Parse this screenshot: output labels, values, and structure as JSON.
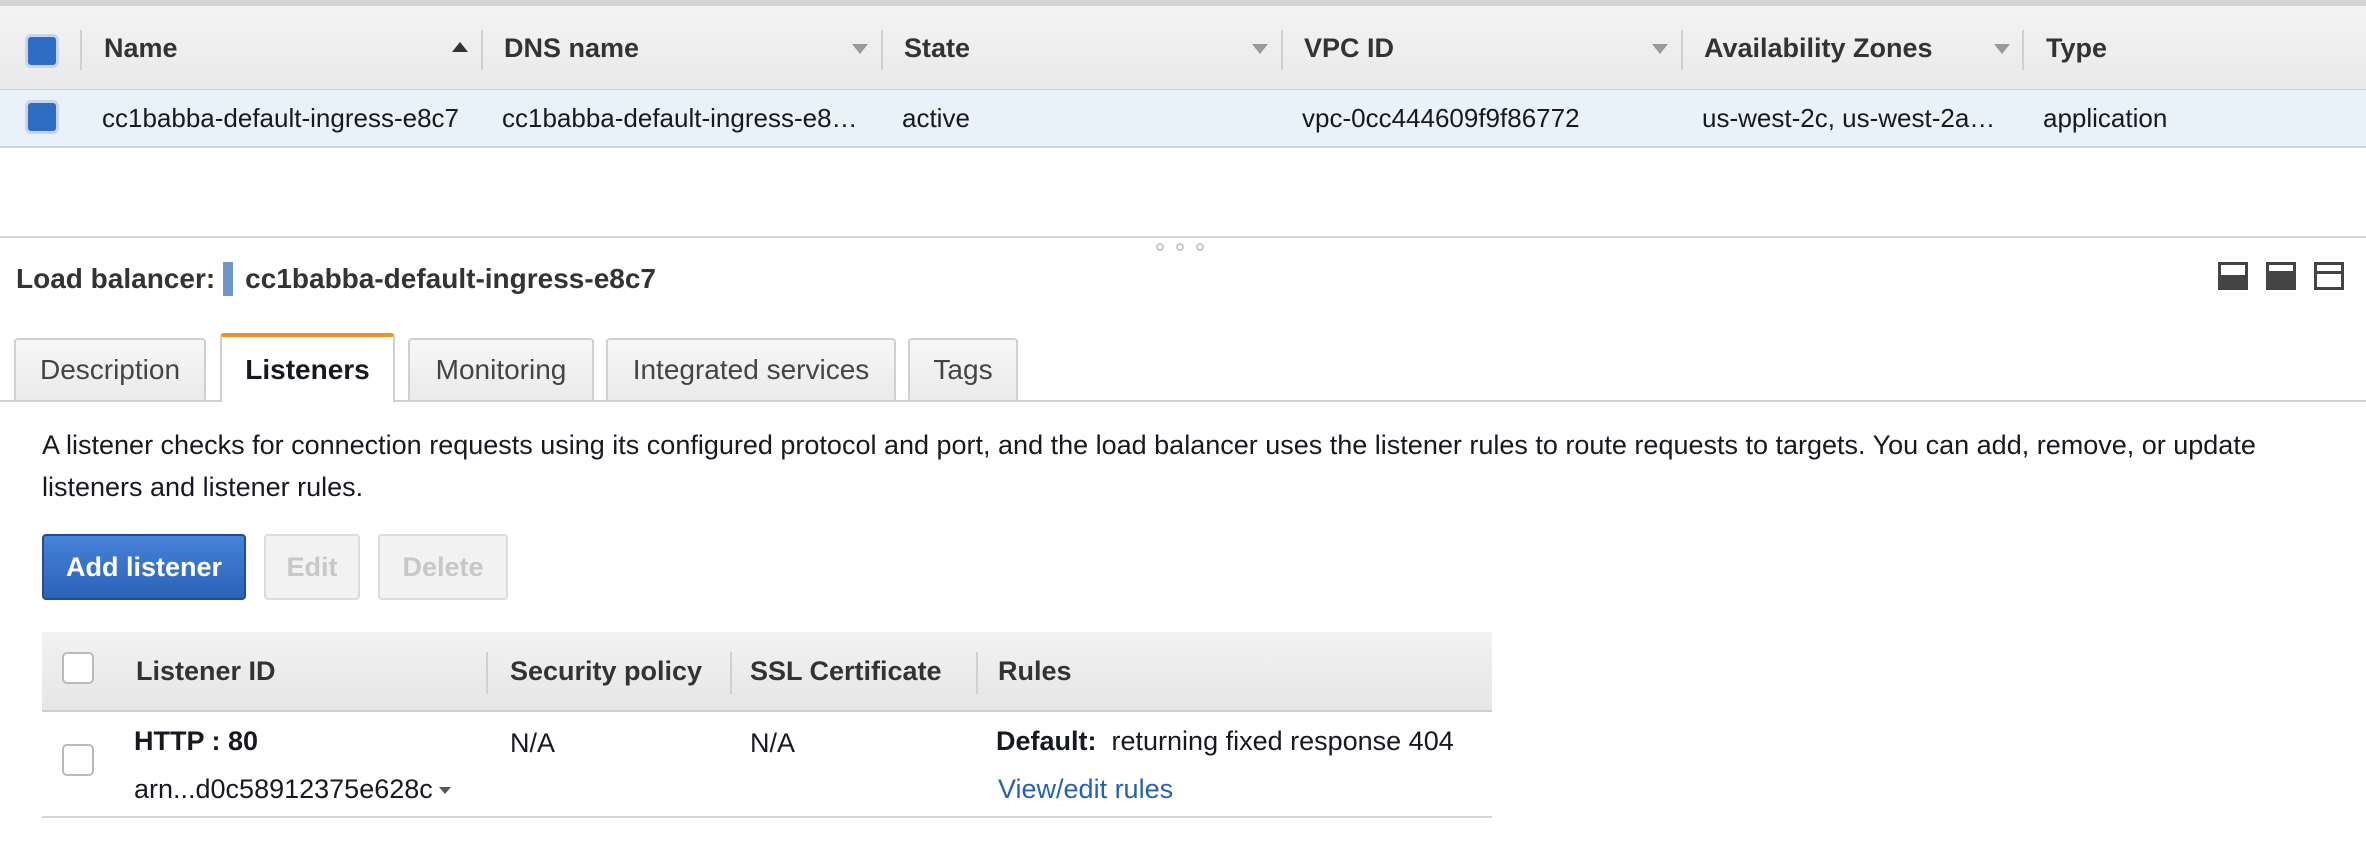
{
  "lb_table": {
    "columns": [
      {
        "label": "Name"
      },
      {
        "label": "DNS name"
      },
      {
        "label": "State"
      },
      {
        "label": "VPC ID"
      },
      {
        "label": "Availability Zones"
      },
      {
        "label": "Type"
      }
    ],
    "rows": [
      {
        "name": "cc1babba-default-ingress-e8c7",
        "dns_name": "cc1babba-default-ingress-e8…",
        "state": "active",
        "vpc_id": "vpc-0cc444609f9f86772",
        "availability_zones": "us-west-2c, us-west-2a…",
        "type": "application",
        "selected": true
      }
    ]
  },
  "detail": {
    "title_label": "Load balancer:",
    "title_value": "cc1babba-default-ingress-e8c7",
    "tabs": [
      {
        "label": "Description"
      },
      {
        "label": "Listeners",
        "active": true
      },
      {
        "label": "Monitoring"
      },
      {
        "label": "Integrated services"
      },
      {
        "label": "Tags"
      }
    ],
    "description": "A listener checks for connection requests using its configured protocol and port, and the load balancer uses the listener rules to route requests to targets. You can add, remove, or update listeners and listener rules.",
    "buttons": {
      "add": "Add listener",
      "edit": "Edit",
      "delete": "Delete"
    }
  },
  "listeners": {
    "columns": [
      "Listener ID",
      "Security policy",
      "SSL Certificate",
      "Rules"
    ],
    "rows": [
      {
        "protocol_port": "HTTP : 80",
        "arn": "arn...d0c58912375e628c",
        "security_policy": "N/A",
        "ssl_certificate": "N/A",
        "rules_default_label": "Default:",
        "rules_default_value": "returning fixed response 404",
        "rules_link": "View/edit rules"
      }
    ]
  },
  "colors": {
    "accent_tab": "#ec912d",
    "primary_button": "#2b62b8",
    "selected_row": "#e9f1fb",
    "link": "#2461b6"
  }
}
